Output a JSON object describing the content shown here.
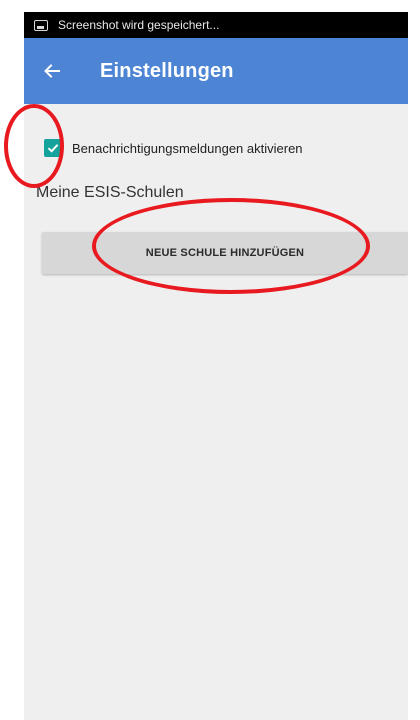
{
  "status_bar": {
    "icon": "screenshot-icon",
    "text": "Screenshot wird gespeichert..."
  },
  "app_bar": {
    "back_icon": "arrow-left-icon",
    "title": "Einstellungen",
    "color": "#4d84d4"
  },
  "settings": {
    "notifications": {
      "label": "Benachrichtigungsmeldungen aktivieren",
      "checked": true,
      "checkbox_color": "#14a39c"
    }
  },
  "schools_section": {
    "title": "Meine ESIS-Schulen",
    "add_button_label": "NEUE SCHULE HINZUFÜGEN"
  },
  "annotations": {
    "color": "#e8191f",
    "shape": "ellipse",
    "targets": [
      "notifications-checkbox",
      "add-school-button"
    ]
  }
}
